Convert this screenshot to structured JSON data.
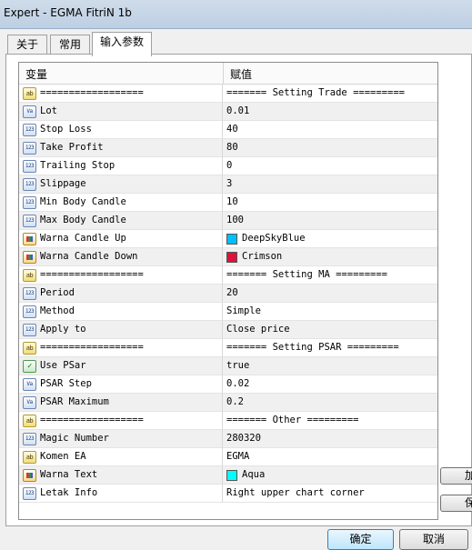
{
  "window": {
    "title": "Expert - EGMA FitriN 1b"
  },
  "tabs": [
    {
      "label": "关于"
    },
    {
      "label": "常用"
    },
    {
      "label": "输入参数"
    }
  ],
  "table": {
    "header": {
      "variable": "变量",
      "value": "赋值"
    },
    "rows": [
      {
        "icon": "ab",
        "name": "==================",
        "value": "======= Setting Trade ========="
      },
      {
        "icon": "va",
        "name": "Lot",
        "value": "0.01"
      },
      {
        "icon": "123",
        "name": "Stop Loss",
        "value": "40"
      },
      {
        "icon": "123",
        "name": "Take Profit",
        "value": "80"
      },
      {
        "icon": "123",
        "name": "Trailing Stop",
        "value": "0"
      },
      {
        "icon": "123",
        "name": "Slippage",
        "value": "3"
      },
      {
        "icon": "123",
        "name": "Min Body Candle",
        "value": "10"
      },
      {
        "icon": "123",
        "name": "Max Body Candle",
        "value": "100"
      },
      {
        "icon": "color",
        "name": "Warna Candle Up",
        "value": "DeepSkyBlue",
        "swatch": "#00bfff"
      },
      {
        "icon": "color",
        "name": "Warna Candle Down",
        "value": "Crimson",
        "swatch": "#dc143c"
      },
      {
        "icon": "ab",
        "name": "==================",
        "value": "======= Setting MA ========="
      },
      {
        "icon": "123",
        "name": "Period",
        "value": "20"
      },
      {
        "icon": "123",
        "name": "Method",
        "value": "Simple"
      },
      {
        "icon": "123",
        "name": "Apply to",
        "value": "Close price"
      },
      {
        "icon": "ab",
        "name": "==================",
        "value": "======= Setting PSAR ========="
      },
      {
        "icon": "bool",
        "name": "Use PSar",
        "value": "true"
      },
      {
        "icon": "va",
        "name": "PSAR Step",
        "value": "0.02"
      },
      {
        "icon": "va",
        "name": "PSAR Maximum",
        "value": "0.2"
      },
      {
        "icon": "ab",
        "name": "==================",
        "value": "======= Other ========="
      },
      {
        "icon": "123",
        "name": "Magic Number",
        "value": "280320"
      },
      {
        "icon": "ab",
        "name": "Komen EA",
        "value": "EGMA"
      },
      {
        "icon": "color",
        "name": "Warna Text",
        "value": "Aqua",
        "swatch": "#00ffff"
      },
      {
        "icon": "123",
        "name": "Letak Info",
        "value": "Right upper chart corner"
      }
    ]
  },
  "side_buttons": [
    {
      "label": "加载"
    },
    {
      "label": "保存"
    }
  ],
  "buttons": {
    "ok": "确定",
    "cancel": "取消"
  },
  "icons": {
    "ab": "ab",
    "va": "Va",
    "123": "123",
    "bool": "✓"
  }
}
